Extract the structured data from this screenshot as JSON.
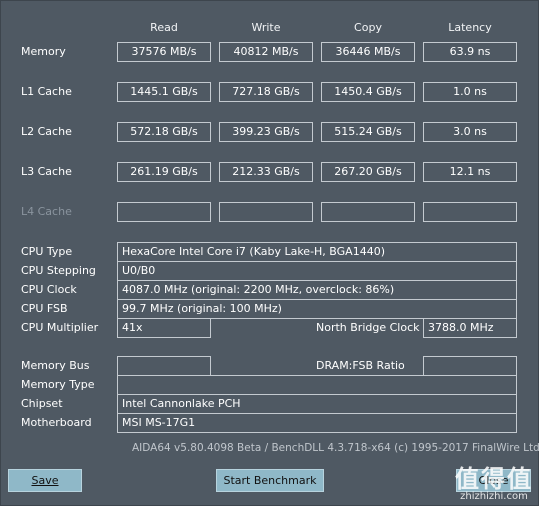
{
  "columns": [
    "Read",
    "Write",
    "Copy",
    "Latency"
  ],
  "bench_rows": [
    {
      "label": "Memory",
      "read": "37576 MB/s",
      "write": "40812 MB/s",
      "copy": "36446 MB/s",
      "latency": "63.9 ns"
    },
    {
      "label": "L1 Cache",
      "read": "1445.1 GB/s",
      "write": "727.18 GB/s",
      "copy": "1450.4 GB/s",
      "latency": "1.0 ns"
    },
    {
      "label": "L2 Cache",
      "read": "572.18 GB/s",
      "write": "399.23 GB/s",
      "copy": "515.24 GB/s",
      "latency": "3.0 ns"
    },
    {
      "label": "L3 Cache",
      "read": "261.19 GB/s",
      "write": "212.33 GB/s",
      "copy": "267.20 GB/s",
      "latency": "12.1 ns"
    },
    {
      "label": "L4 Cache",
      "read": "",
      "write": "",
      "copy": "",
      "latency": ""
    }
  ],
  "info": {
    "cpu_type_label": "CPU Type",
    "cpu_type": "HexaCore Intel Core i7  (Kaby Lake-H, BGA1440)",
    "cpu_stepping_label": "CPU Stepping",
    "cpu_stepping": "U0/B0",
    "cpu_clock_label": "CPU Clock",
    "cpu_clock": "4087.0 MHz  (original: 2200 MHz, overclock: 86%)",
    "cpu_fsb_label": "CPU FSB",
    "cpu_fsb": "99.7 MHz  (original: 100 MHz)",
    "cpu_multiplier_label": "CPU Multiplier",
    "cpu_multiplier": "41x",
    "nb_clock_label": "North Bridge Clock",
    "nb_clock": "3788.0 MHz",
    "memory_bus_label": "Memory Bus",
    "memory_bus": "",
    "dram_fsb_label": "DRAM:FSB Ratio",
    "dram_fsb": "",
    "memory_type_label": "Memory Type",
    "memory_type": "",
    "chipset_label": "Chipset",
    "chipset": "Intel Cannonlake PCH",
    "motherboard_label": "Motherboard",
    "motherboard": "MSI MS-17G1"
  },
  "footer": "AIDA64 v5.80.4098 Beta / BenchDLL 4.3.718-x64  (c) 1995-2017 FinalWire Ltd.",
  "buttons": {
    "save": "Save",
    "start": "Start Benchmark",
    "close": "Close"
  },
  "watermark": {
    "big": "值得值",
    "small": "zhizhizhi.com"
  },
  "colors": {
    "background": "#4f5963",
    "button": "#8fb8c8",
    "box_border": "#c4cad0"
  }
}
